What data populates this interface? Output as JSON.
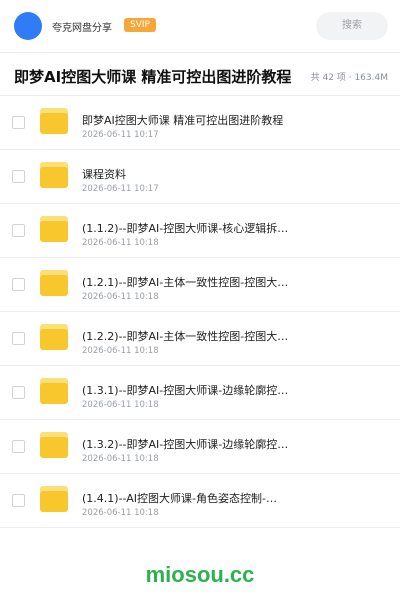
{
  "header": {
    "app_name": "夸克网盘分享",
    "badge": "SVIP",
    "search_placeholder": "搜索"
  },
  "share": {
    "title": "即梦AI控图大师课 精准可控出图进阶教程",
    "meta": "共 42 项 · 163.4M"
  },
  "files": [
    {
      "name": "即梦AI控图大师课 精准可控出图进阶教程",
      "date": "2026-06-11 10:17"
    },
    {
      "name": "课程资料",
      "date": "2026-06-11 10:17"
    },
    {
      "name": "(1.1.2)--即梦AI-控图大师课-核心逻辑拆…",
      "date": "2026-06-11 10:18"
    },
    {
      "name": "(1.2.1)--即梦AI-主体一致性控图-控图大…",
      "date": "2026-06-11 10:18"
    },
    {
      "name": "(1.2.2)--即梦AI-主体一致性控图-控图大…",
      "date": "2026-06-11 10:18"
    },
    {
      "name": "(1.3.1)--即梦AI-控图大师课-边缘轮廓控…",
      "date": "2026-06-11 10:18"
    },
    {
      "name": "(1.3.2)--即梦AI-控图大师课-边缘轮廓控…",
      "date": "2026-06-11 10:18"
    },
    {
      "name": "(1.4.1)--AI控图大师课-角色姿态控制-…",
      "date": "2026-06-11 10:18"
    }
  ],
  "watermark": "miosou.cc",
  "colors": {
    "accent": "#2f7cf6",
    "svip": "#f7a73a",
    "folder": "#f8c62d",
    "watermark": "#2bb24c"
  }
}
